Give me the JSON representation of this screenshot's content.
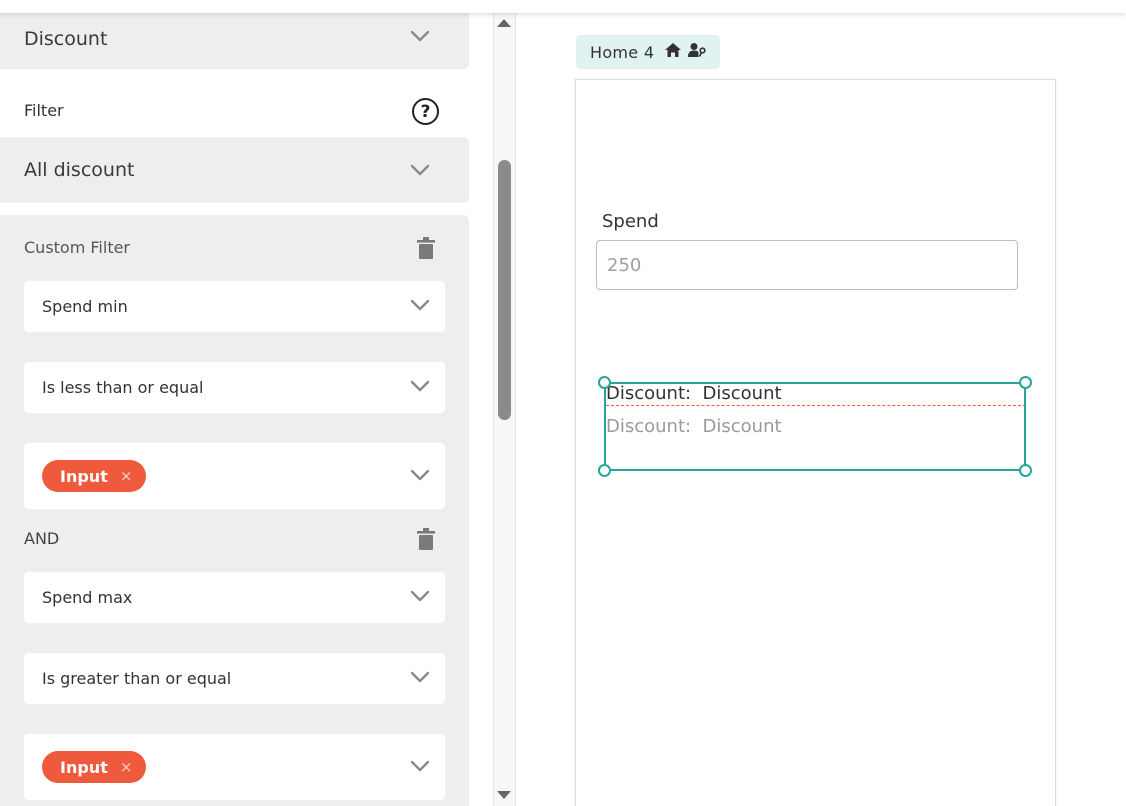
{
  "left_panel": {
    "discount_dropdown": "Discount",
    "filter_label": "Filter",
    "filter_dropdown": "All discount",
    "custom_filter": {
      "title": "Custom Filter",
      "conditions": [
        {
          "field": "Spend min",
          "operator": "Is less than or equal",
          "value_chip": "Input",
          "chip_remove": "×"
        },
        {
          "field": "Spend max",
          "operator": "Is greater than or equal",
          "value_chip": "Input",
          "chip_remove": "×"
        }
      ],
      "and_label": "AND"
    }
  },
  "canvas": {
    "page_tag": "Home 4",
    "page_tag_icons": [
      "home-icon",
      "user-key-icon"
    ],
    "spend_label": "Spend",
    "spend_input_placeholder": "250",
    "discount_label_text": "Discount:  Discount",
    "discount_value_text": "Discount:  Discount"
  },
  "colors": {
    "accent_chip": "#f05a3c",
    "selection": "#26a69a",
    "panel_bg": "#eeeeee",
    "page_tag_bg": "#e0f2f1"
  }
}
